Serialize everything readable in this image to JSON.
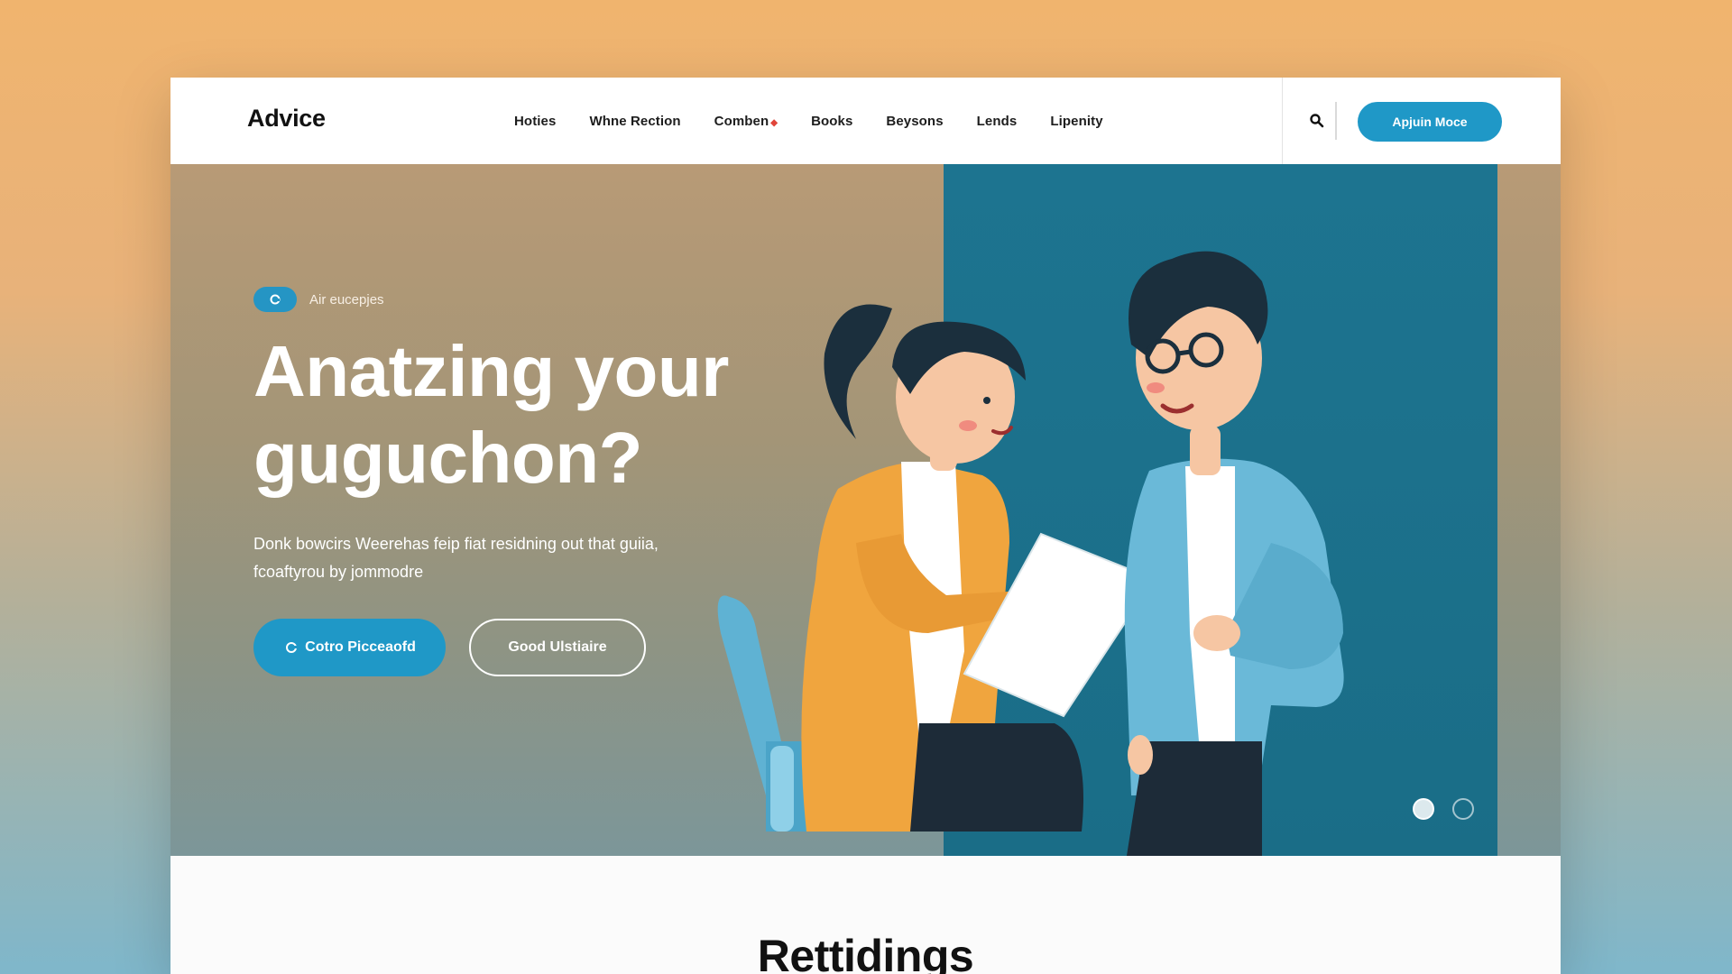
{
  "brand": {
    "logo": "Advice"
  },
  "nav": {
    "items": [
      {
        "label": "Hoties",
        "has_indicator": false
      },
      {
        "label": "Whne Rection",
        "has_indicator": false
      },
      {
        "label": "Comben",
        "has_indicator": true
      },
      {
        "label": "Books",
        "has_indicator": false
      },
      {
        "label": "Beysons",
        "has_indicator": false
      },
      {
        "label": "Lends",
        "has_indicator": false
      },
      {
        "label": "Lipenity",
        "has_indicator": false
      }
    ],
    "search_icon": "search-icon",
    "cta_label": "Apjuin Moce"
  },
  "hero": {
    "badge_text": "Air eucepjes",
    "headline_line1": "Anatzing your",
    "headline_line2": "guguchon?",
    "subtext_line1": "Donk bowcirs Weerehas feip fiat residning out that guiia,",
    "subtext_line2": "fcoaftyrou by jommodre",
    "primary_button": "Cotro Picceaofd",
    "secondary_button": "Good Ulstiaire",
    "carousel": {
      "total": 2,
      "active_index": 0
    }
  },
  "section": {
    "title": "Rettidings"
  },
  "colors": {
    "accent": "#1f98c7",
    "panel": "#1d7490",
    "indicator": "#e0453a"
  }
}
